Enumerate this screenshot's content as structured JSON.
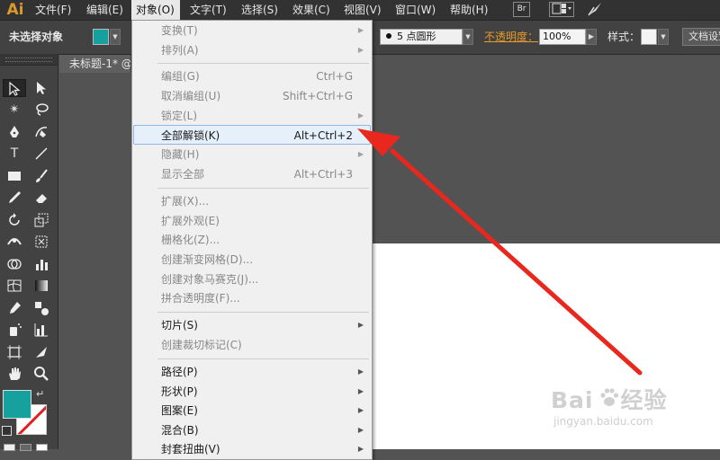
{
  "app": {
    "logo": "Ai"
  },
  "menubar": {
    "items": [
      {
        "label": "文件(F)"
      },
      {
        "label": "编辑(E)"
      },
      {
        "label": "对象(O)"
      },
      {
        "label": "文字(T)"
      },
      {
        "label": "选择(S)"
      },
      {
        "label": "效果(C)"
      },
      {
        "label": "视图(V)"
      },
      {
        "label": "窗口(W)"
      },
      {
        "label": "帮助(H)"
      }
    ],
    "bridge_label": "Br"
  },
  "controlbar": {
    "selection_status": "未选择对象",
    "fill_color": "#16a19f",
    "brush_label": "5 点圆形",
    "opacity_label": "不透明度：",
    "opacity_value": "100%",
    "style_label": "样式：",
    "doc_setup_label": "文档设置"
  },
  "document": {
    "tab_title": "未标题-1* @",
    "artboard_color": "#ffffff"
  },
  "swatches": {
    "fill": "#16a19f",
    "stroke_slash": "#e02020"
  },
  "object_menu": {
    "items": [
      {
        "label": "变换(T)",
        "shortcut": "",
        "submenu": true
      },
      {
        "label": "排列(A)",
        "shortcut": "",
        "submenu": true
      },
      {
        "label": "编组(G)",
        "shortcut": "Ctrl+G",
        "submenu": false
      },
      {
        "label": "取消编组(U)",
        "shortcut": "Shift+Ctrl+G",
        "submenu": false
      },
      {
        "label": "锁定(L)",
        "shortcut": "",
        "submenu": true
      },
      {
        "label": "全部解锁(K)",
        "shortcut": "Alt+Ctrl+2",
        "submenu": false
      },
      {
        "label": "隐藏(H)",
        "shortcut": "",
        "submenu": true
      },
      {
        "label": "显示全部",
        "shortcut": "Alt+Ctrl+3",
        "submenu": false
      },
      {
        "label": "扩展(X)...",
        "shortcut": "",
        "submenu": false
      },
      {
        "label": "扩展外观(E)",
        "shortcut": "",
        "submenu": false
      },
      {
        "label": "栅格化(Z)...",
        "shortcut": "",
        "submenu": false
      },
      {
        "label": "创建渐变网格(D)...",
        "shortcut": "",
        "submenu": false
      },
      {
        "label": "创建对象马赛克(J)...",
        "shortcut": "",
        "submenu": false
      },
      {
        "label": "拼合透明度(F)...",
        "shortcut": "",
        "submenu": false
      },
      {
        "label": "切片(S)",
        "shortcut": "",
        "submenu": true
      },
      {
        "label": "创建裁切标记(C)",
        "shortcut": "",
        "submenu": false
      },
      {
        "label": "路径(P)",
        "shortcut": "",
        "submenu": true
      },
      {
        "label": "形状(P)",
        "shortcut": "",
        "submenu": true
      },
      {
        "label": "图案(E)",
        "shortcut": "",
        "submenu": true
      },
      {
        "label": "混合(B)",
        "shortcut": "",
        "submenu": true
      },
      {
        "label": "封套扭曲(V)",
        "shortcut": "",
        "submenu": true
      }
    ]
  },
  "annotation": {
    "arrow_color": "#e8281e"
  },
  "watermark": {
    "logo_text": "Bai",
    "logo_text2": "经验",
    "url": "jingyan.baidu.com"
  }
}
